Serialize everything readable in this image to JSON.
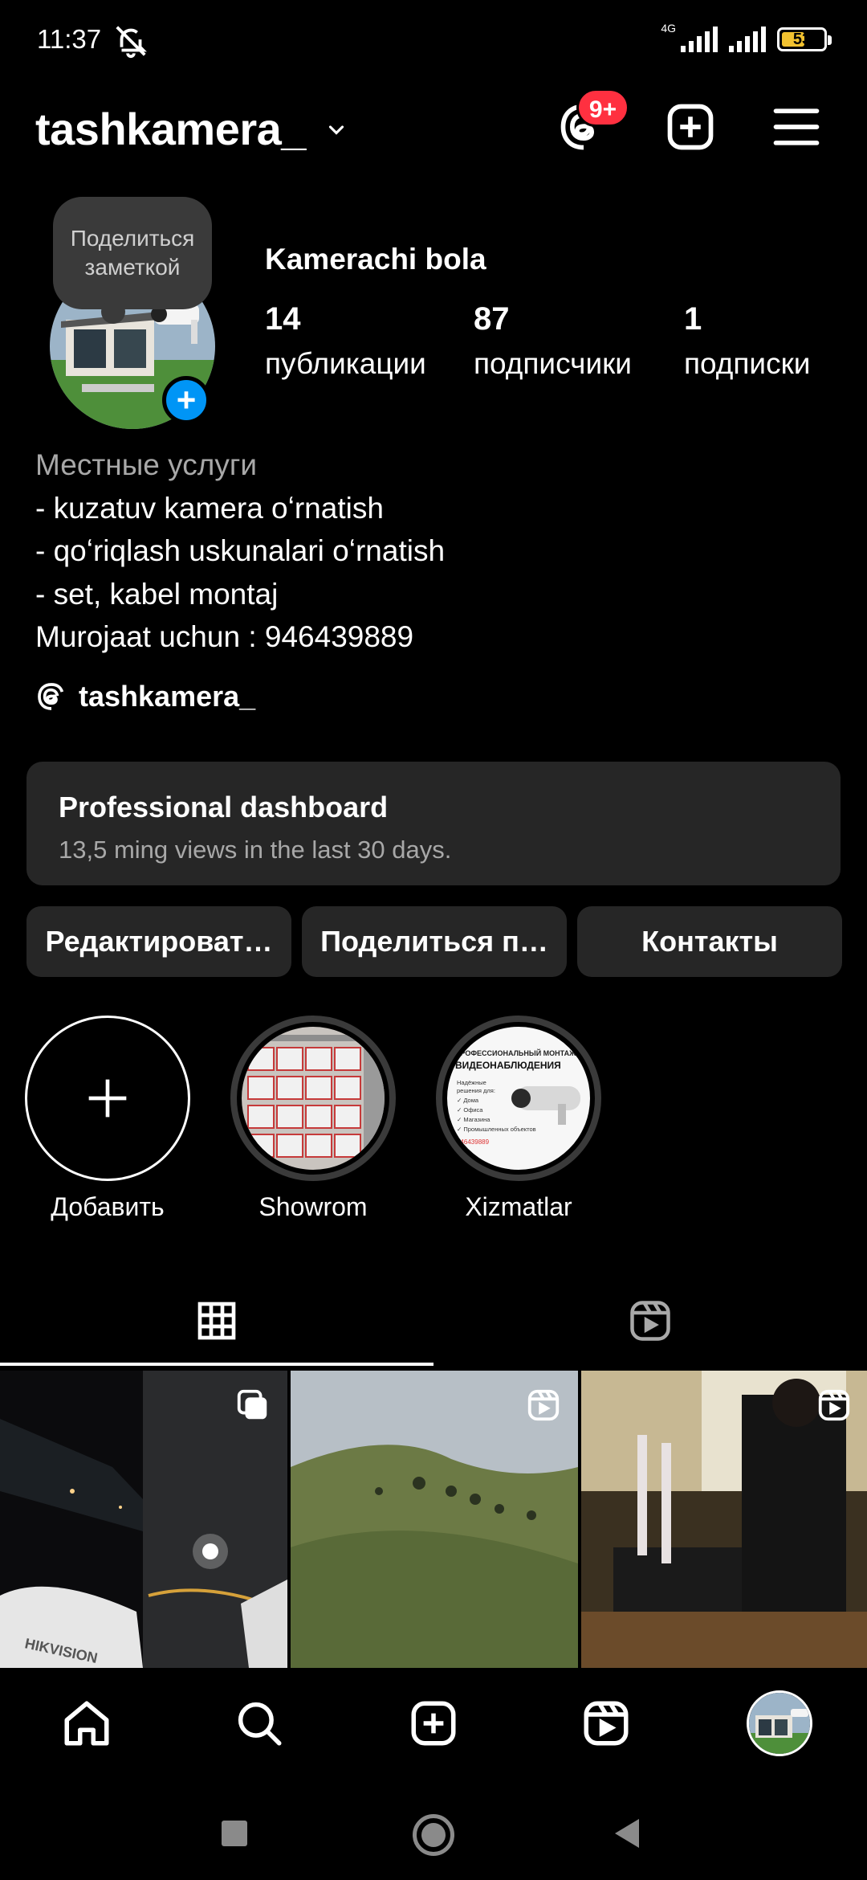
{
  "status_bar": {
    "time": "11:37",
    "network": "4G",
    "battery": "53",
    "icons": [
      "mute-icon",
      "signal-icon",
      "signal-icon",
      "battery-icon"
    ]
  },
  "header": {
    "username": "tashkamera_",
    "threads_badge": "9+",
    "icons": [
      "chevron-down-icon",
      "threads-icon",
      "create-post-icon",
      "menu-icon"
    ]
  },
  "profile": {
    "note_prompt": "Поделиться заметкой",
    "display_name": "Kamerachi bola",
    "stats": [
      {
        "value": "14",
        "label": "публикации"
      },
      {
        "value": "87",
        "label": "подписчики"
      },
      {
        "value": "1",
        "label": "подписки"
      }
    ],
    "bio": {
      "category": "Местные услуги",
      "lines": [
        "- kuzatuv kamera oʻrnatish",
        "- qoʻriqlash uskunalari oʻrnatish",
        "- set, kabel montaj",
        "Murojaat uchun : 946439889"
      ]
    },
    "threads_handle": "tashkamera_"
  },
  "dashboard": {
    "title": "Professional dashboard",
    "subtitle": "13,5 ming views in the last 30 days."
  },
  "actions": {
    "edit": "Редактироват…",
    "share": "Поделиться п…",
    "contacts": "Контакты"
  },
  "highlights": [
    {
      "label": "Добавить"
    },
    {
      "label": "Showrom"
    },
    {
      "label": "Xizmatlar"
    }
  ],
  "highlight_image_text": {
    "xizmatlar_top": "ПРОФЕССИОНАЛЬНЫЙ МОНТАЖ СИСТЕМ",
    "xizmatlar_title": "ВИДЕОНАБЛЮДЕНИЯ",
    "xizmatlar_list": [
      "Надёжные",
      "решения для:",
      "✓ Дома",
      "✓ Офиса",
      "✓ Магазина",
      "✓ Промышленных объектов"
    ],
    "xizmatlar_phone": "946439889"
  },
  "posts": [
    {
      "type": "carousel",
      "overlay_text": "HIKVISION"
    },
    {
      "type": "reel"
    },
    {
      "type": "reel"
    }
  ],
  "tabs": [
    "grid-icon",
    "reels-icon"
  ],
  "bottom_nav": [
    "home-icon",
    "search-icon",
    "create-icon",
    "reels-icon",
    "profile-avatar"
  ],
  "colors": {
    "background": "#000000",
    "surface": "#262626",
    "secondary_text": "#a8a8a8",
    "accent_blue": "#0095f6",
    "badge_red": "#ff3040"
  }
}
